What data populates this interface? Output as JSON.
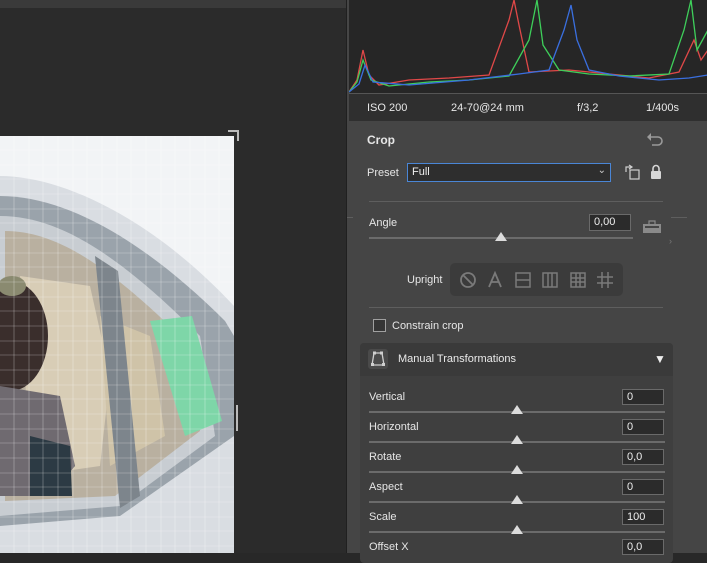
{
  "camera_info": {
    "iso": "ISO 200",
    "lens": "24-70@24 mm",
    "aperture": "f/3,2",
    "shutter": "1/400s"
  },
  "crop": {
    "title": "Crop",
    "preset_label": "Preset",
    "preset_value": "Full",
    "angle_label": "Angle",
    "angle_value": "0,00",
    "upright_label": "Upright",
    "constrain_label": "Constrain crop"
  },
  "manual_transformations": {
    "title": "Manual Transformations",
    "rows": [
      {
        "label": "Vertical",
        "value": "0"
      },
      {
        "label": "Horizontal",
        "value": "0"
      },
      {
        "label": "Rotate",
        "value": "0,0"
      },
      {
        "label": "Aspect",
        "value": "0"
      },
      {
        "label": "Scale",
        "value": "100"
      },
      {
        "label": "Offset X",
        "value": "0,0"
      }
    ]
  },
  "icons": {
    "reset": "reset-icon",
    "rotate_crop": "rotate-crop-icon",
    "lock": "lock-icon",
    "level": "level-icon",
    "upright_buttons": [
      "upright-off-icon",
      "upright-auto-icon",
      "upright-level-icon",
      "upright-vertical-icon",
      "upright-full-icon",
      "upright-guided-icon"
    ],
    "transform": "transform-icon",
    "caret": "caret-down-icon"
  },
  "colors": {
    "panel_bg": "#454545",
    "accent_border": "#4a86d6",
    "histogram_red": "#e04848",
    "histogram_green": "#3ecf5a",
    "histogram_blue": "#3a6fe0"
  }
}
